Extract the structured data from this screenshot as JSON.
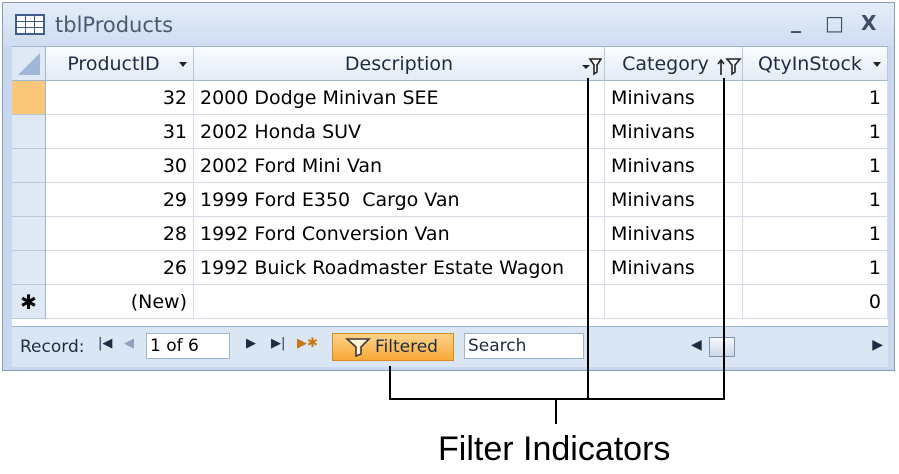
{
  "window": {
    "title": "tblProducts",
    "minimize_glyph": "_",
    "maximize_glyph": "□",
    "close_glyph": "X"
  },
  "columns": [
    {
      "label": "ProductID",
      "indicator": "dropdown"
    },
    {
      "label": "Description",
      "indicator": "filter"
    },
    {
      "label": "Category",
      "indicator": "sort-filter"
    },
    {
      "label": "QtyInStock",
      "indicator": "dropdown"
    }
  ],
  "rows": [
    {
      "id": "32",
      "description": "2000 Dodge Minivan SEE",
      "category": "Minivans",
      "qty": "1"
    },
    {
      "id": "31",
      "description": "2002 Honda SUV",
      "category": "Minivans",
      "qty": "1"
    },
    {
      "id": "30",
      "description": "2002 Ford Mini Van",
      "category": "Minivans",
      "qty": "1"
    },
    {
      "id": "29",
      "description": "1999 Ford E350  Cargo Van",
      "category": "Minivans",
      "qty": "1"
    },
    {
      "id": "28",
      "description": "1992 Ford Conversion Van",
      "category": "Minivans",
      "qty": "1"
    },
    {
      "id": "26",
      "description": "1992 Buick Roadmaster Estate Wagon",
      "category": "Minivans",
      "qty": "1"
    }
  ],
  "new_row": {
    "marker": "✱",
    "id": "(New)",
    "qty": "0"
  },
  "navigation": {
    "record_label": "Record:",
    "record_value": "1 of 6",
    "filtered_label": "Filtered",
    "search_label": "Search"
  },
  "callout": {
    "label": "Filter Indicators"
  },
  "colors": {
    "current_row": "#f9c67a",
    "filtered_button": "#f7a937"
  }
}
